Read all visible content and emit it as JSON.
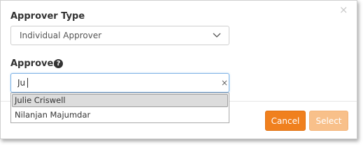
{
  "dialog": {
    "close_glyph": "×"
  },
  "approver_type": {
    "label": "Approver Type",
    "selected": "Individual Approver",
    "icon": "chevron-down-icon"
  },
  "approver": {
    "label": "Approver",
    "help_icon_glyph": "?",
    "input_value": "Ju",
    "clear_glyph": "×",
    "suggestions": [
      {
        "label": "Julie Criswell",
        "highlighted": true
      },
      {
        "label": "Nilanjan Majumdar",
        "highlighted": false
      }
    ]
  },
  "buttons": {
    "cancel_label": "Cancel",
    "select_label": "Select"
  },
  "colors": {
    "primary_button": "#f0801e",
    "disabled_button": "#f8c08a",
    "focus_border": "#7fb2e5"
  }
}
